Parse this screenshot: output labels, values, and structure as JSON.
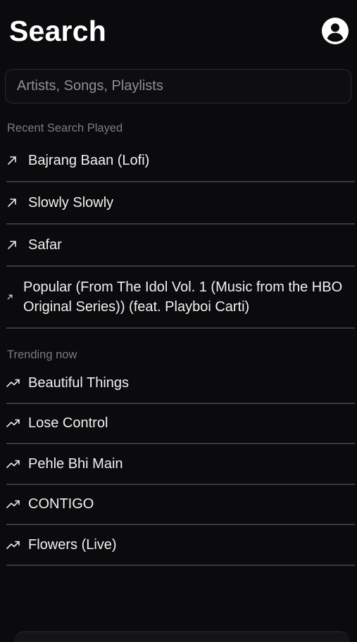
{
  "header": {
    "title": "Search",
    "profile_icon": "account-circle-icon"
  },
  "search": {
    "placeholder": "Artists, Songs, Playlists",
    "value": ""
  },
  "recent": {
    "title": "Recent Search Played",
    "icon": "arrow-up-right-icon",
    "items": [
      {
        "label": "Bajrang Baan (Lofi)"
      },
      {
        "label": "Slowly Slowly"
      },
      {
        "label": "Safar"
      },
      {
        "label": "Popular (From The Idol Vol. 1 (Music from the HBO Original Series)) (feat. Playboi Carti)"
      }
    ]
  },
  "trending": {
    "title": "Trending now",
    "icon": "trending-up-icon",
    "items": [
      {
        "label": "Beautiful Things"
      },
      {
        "label": "Lose Control"
      },
      {
        "label": "Pehle Bhi Main"
      },
      {
        "label": "CONTIGO"
      },
      {
        "label": "Flowers (Live)"
      }
    ]
  },
  "colors": {
    "background": "#0b0b0d",
    "text": "#f1f1f1",
    "muted": "#7b7b82",
    "divider": "#3a3a3e"
  }
}
